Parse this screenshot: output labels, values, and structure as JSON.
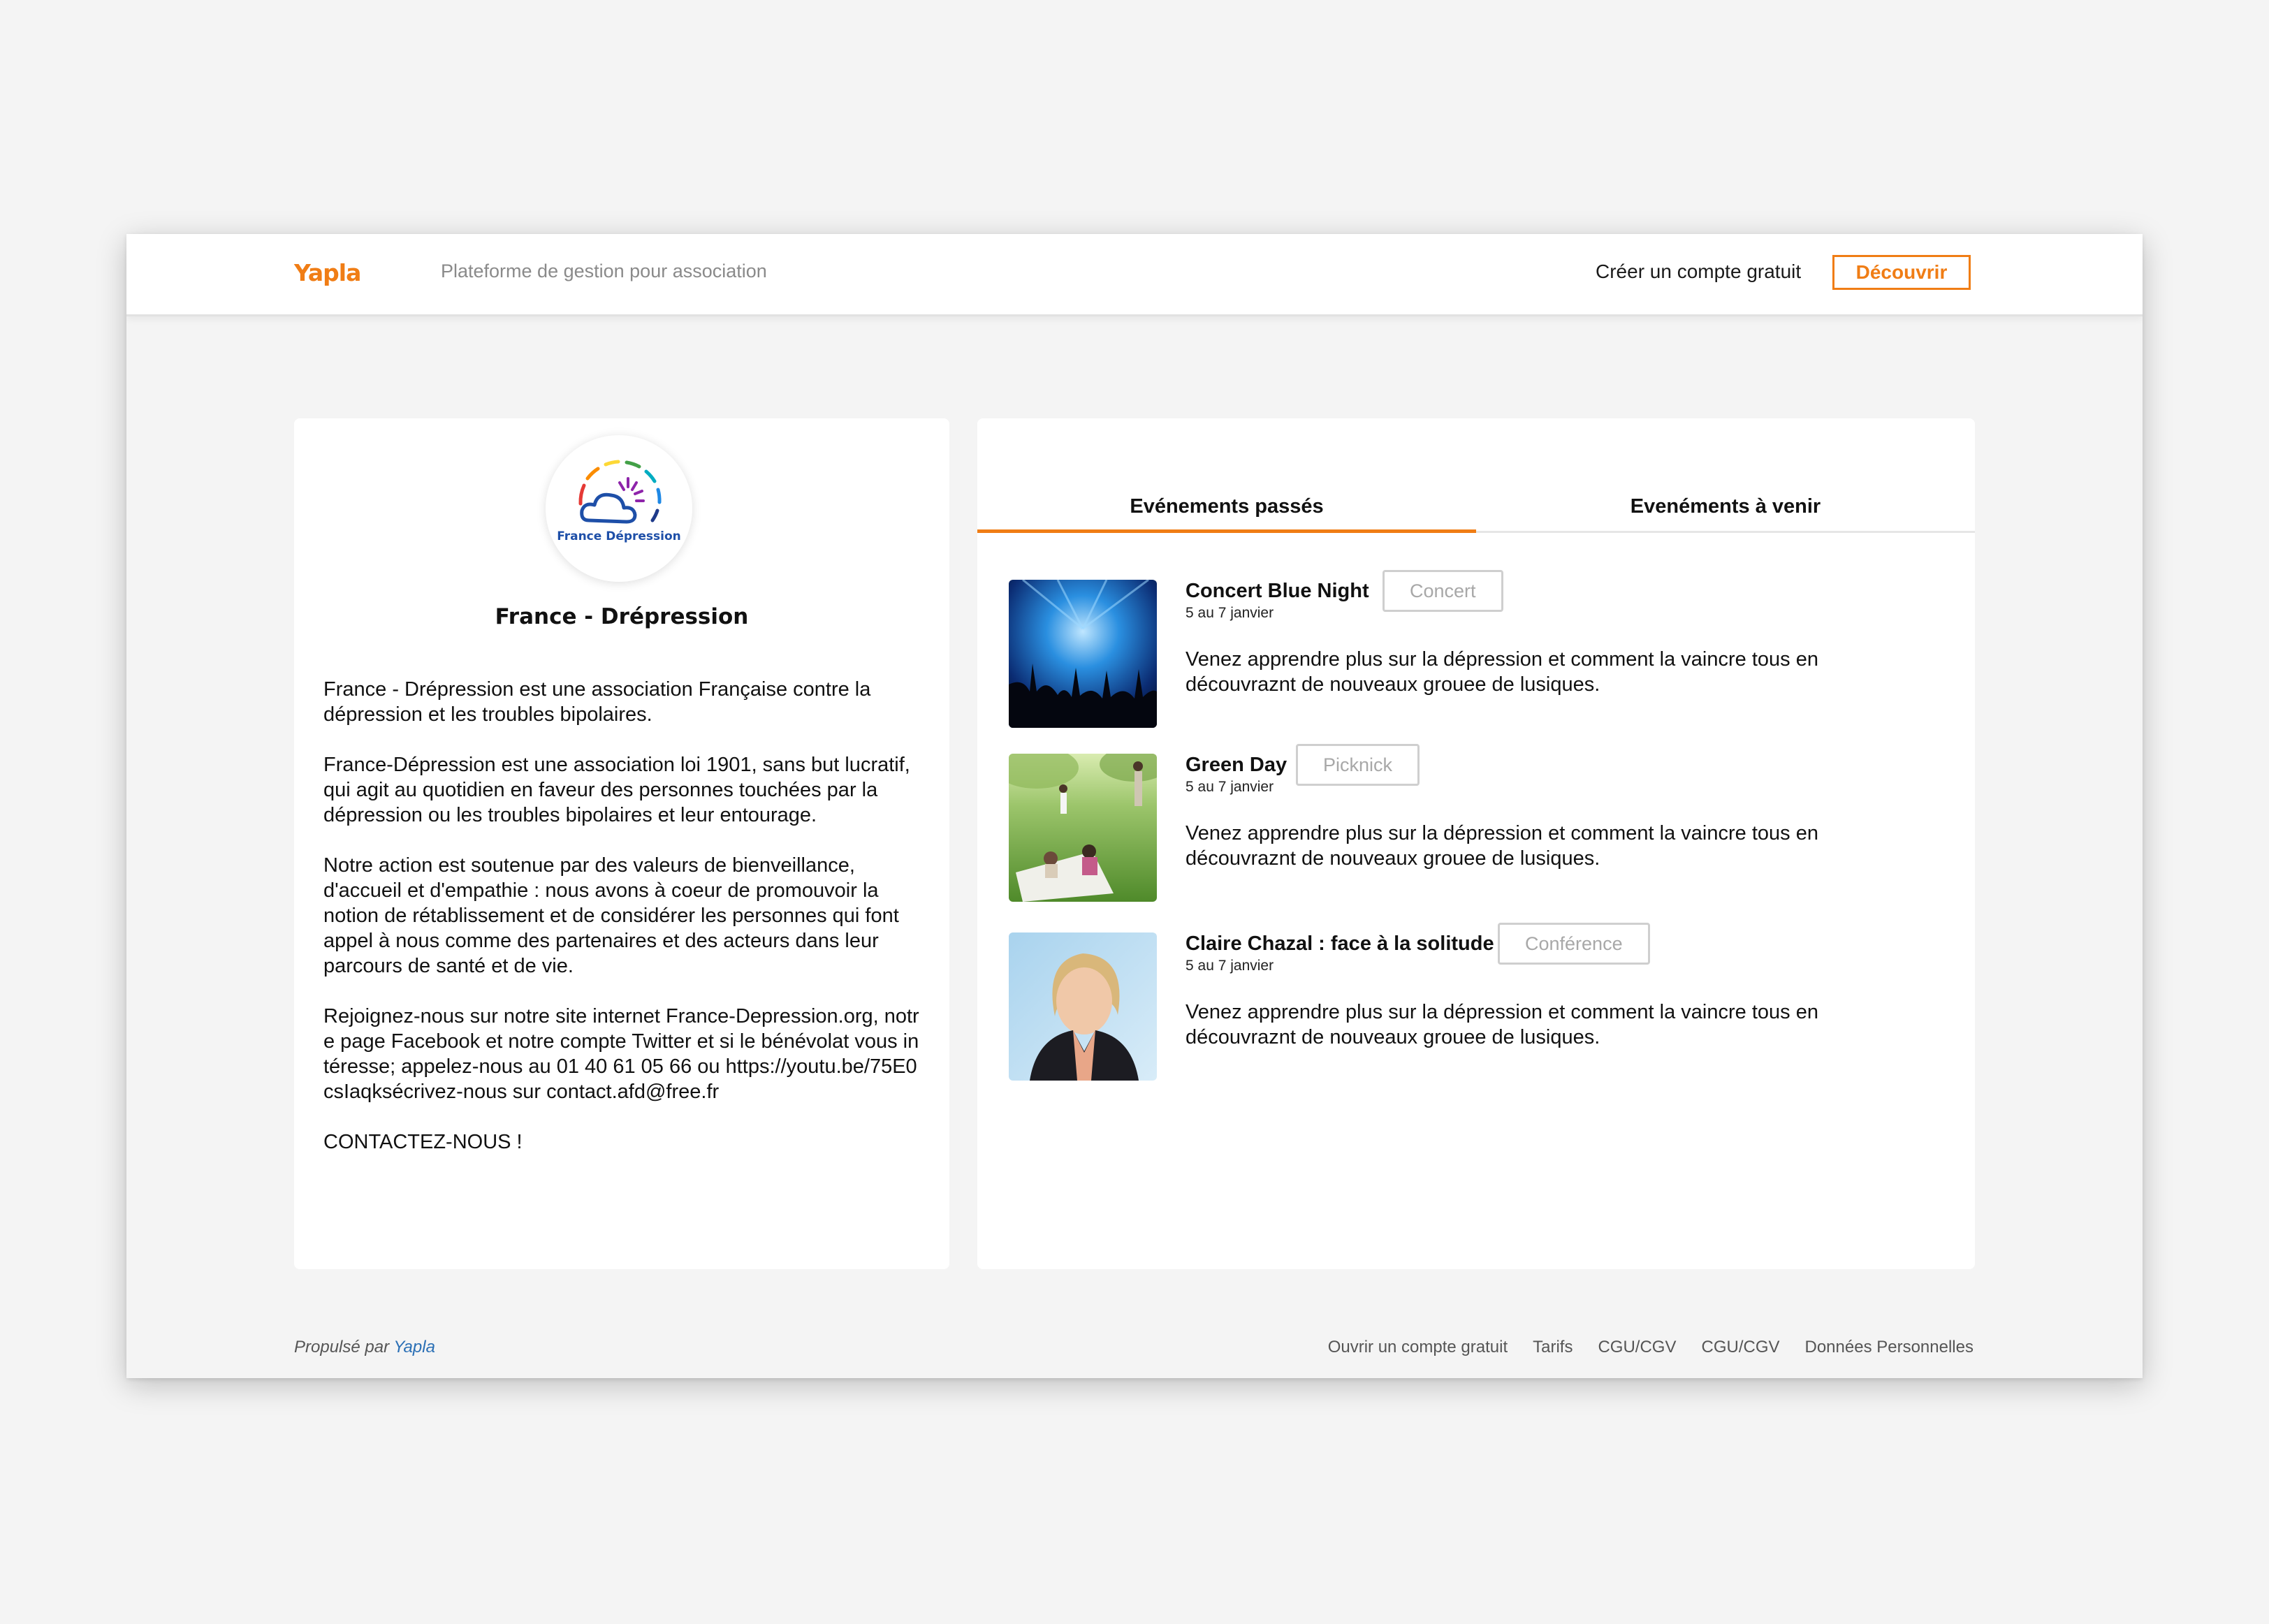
{
  "header": {
    "brand": "Yapla",
    "tagline": "Plateforme de gestion pour association",
    "create_account": "Créer un compte gratuit",
    "discover": "Découvrir"
  },
  "organization": {
    "logo_text": "France Dépression",
    "name": "France - Drépression",
    "about": [
      "France - Drépression est une association Française contre la dépression et les troubles bipolaires.",
      "France-Dépression est une association loi 1901, sans but lucratif, qui agit au quotidien en faveur des personnes touchées par la dépression ou les troubles bipolaires et leur entourage.",
      "Notre action est soutenue par des valeurs de bienveillance, d'accueil et d'empathie : nous avons à coeur de promouvoir la notion de rétablissement et de considérer les personnes qui font appel à nous comme des partenaires et des acteurs dans leur parcours de santé et de vie.",
      "Rejoignez-nous sur notre site internet France-Depression.org, notre page Facebook et notre compte Twitter et si le bénévolat vous intéresse; appelez-nous au 01 40 61 05 66 ou https://youtu.be/75E0csIaqksécrivez-nous sur contact.afd@free.fr",
      "CONTACTEZ-NOUS !"
    ]
  },
  "tabs": {
    "past": "Evénements passés",
    "upcoming": "Evenéments à venir"
  },
  "events": [
    {
      "title": "Concert Blue Night",
      "date": "5 au 7 janvier",
      "tag": "Concert",
      "description": "Venez apprendre plus sur la dépression et comment la vaincre tous en découvraznt de nouveaux grouee de lusiques.",
      "image": "concert-crowd"
    },
    {
      "title": "Green Day",
      "date": "5 au 7 janvier",
      "tag": "Picknick",
      "description": "Venez apprendre plus sur la dépression et comment la vaincre tous en découvraznt de nouveaux grouee de lusiques.",
      "image": "park-picnic"
    },
    {
      "title": "Claire Chazal : face à la solitude",
      "date": "5 au 7 janvier",
      "tag": "Conférence",
      "description": "Venez apprendre plus sur la dépression et comment la vaincre tous en découvraznt de nouveaux grouee de lusiques.",
      "image": "woman-portrait"
    }
  ],
  "footer": {
    "powered_by": "Propulsé par",
    "powered_brand": "Yapla",
    "links": [
      "Ouvrir un compte gratuit",
      "Tarifs",
      "CGU/CGV",
      "CGU/CGV",
      "Données Personnelles"
    ]
  },
  "colors": {
    "accent": "#f07d15",
    "link": "#2a6fb5",
    "background": "#f4f4f4"
  }
}
